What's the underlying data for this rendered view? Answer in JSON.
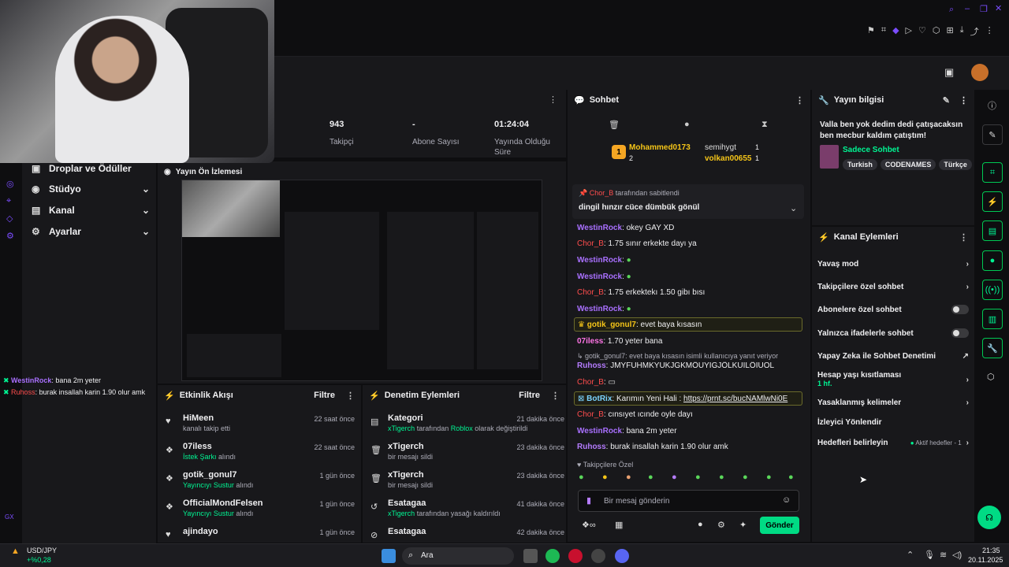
{
  "title_bar": {
    "icons": [
      "search-icon",
      "restore-icon",
      "maximize-icon",
      "close-icon"
    ]
  },
  "toolbar_icons": [
    "bookmark-icon",
    "crop-icon",
    "shield-icon",
    "play-icon",
    "heart-icon",
    "extension-icon",
    "apps-icon",
    "download-icon",
    "share-icon",
    "more-icon"
  ],
  "stats": [
    {
      "value": "943",
      "label": "Takipçi"
    },
    {
      "value": "-",
      "label": "Abone Sayısı"
    },
    {
      "value": "01:24:04",
      "label": "Yayında Olduğu Süre"
    }
  ],
  "nav": [
    {
      "label": "Droplar ve Ödüller"
    },
    {
      "label": "Stüdyo"
    },
    {
      "label": "Kanal"
    },
    {
      "label": "Ayarlar"
    }
  ],
  "preview": {
    "title": "Yayın Ön İzlemesi"
  },
  "overlay_chat": [
    {
      "user": "WestinRock",
      "msg": ": bana 2m yeter"
    },
    {
      "user": "Ruhoss",
      "msg": ": burak insallah karin 1.90 olur amk"
    }
  ],
  "activity": {
    "title": "Etkinlik Akışı",
    "filter": "Filtre",
    "items": [
      {
        "name": "HiMeen",
        "desc": "kanalı takip etti",
        "desc_hl": "",
        "time": "22 saat önce"
      },
      {
        "name": "07iless",
        "desc": " alındı",
        "desc_hl": "İstek Şarkı",
        "time": "22 saat önce"
      },
      {
        "name": "gotik_gonul7",
        "desc": " alındı",
        "desc_hl": "Yayıncıyı Sustur",
        "time": "1 gün önce"
      },
      {
        "name": "OfficialMondFelsen",
        "desc": " alındı",
        "desc_hl": "Yayıncıyı Sustur",
        "time": "1 gün önce"
      },
      {
        "name": "ajindayo",
        "desc": "",
        "desc_hl": "",
        "time": "1 gün önce"
      }
    ]
  },
  "moderation": {
    "title": "Denetim Eylemleri",
    "filter": "Filtre",
    "items": [
      {
        "name": "Kategori",
        "actor": "xTigerch",
        "desc": " tarafından ",
        "target": "Roblox",
        "tail": " olarak değiştirildi",
        "time": "21 dakika önce"
      },
      {
        "name": "xTigerch",
        "actor": "",
        "desc": "bir mesajı sildi",
        "target": "",
        "tail": "",
        "time": "23 dakika önce"
      },
      {
        "name": "xTigerch",
        "actor": "",
        "desc": "bir mesajı sildi",
        "target": "",
        "tail": "",
        "time": "23 dakika önce"
      },
      {
        "name": "Esatagaa",
        "actor": "xTigerch",
        "desc": " tarafından yasağı kaldırıldı",
        "target": "",
        "tail": "",
        "time": "41 dakika önce"
      },
      {
        "name": "Esatagaa",
        "actor": "",
        "desc": "",
        "target": "",
        "tail": "",
        "time": "42 dakika önce"
      }
    ]
  },
  "chat": {
    "title": "Sohbet",
    "leaders": [
      {
        "rank": "1",
        "name": "Mohammed0173",
        "count": "2"
      },
      {
        "name": "semihygt",
        "count": "1"
      },
      {
        "name": "volkan00655",
        "count": "1"
      }
    ],
    "pinned": {
      "by": "Chor_B",
      "by_text": " tarafından sabitlendi",
      "msg": "dingil hınzır cüce dümbük gönül"
    },
    "lines": [
      {
        "user": "WestinRock",
        "cls": "uw",
        "msg": ": okey GAY XD"
      },
      {
        "user": "Chor_B",
        "cls": "uc",
        "msg": ": 1.75 sınır erkekte dayı ya"
      },
      {
        "user": "WestinRock",
        "cls": "uw",
        "msg": ":"
      },
      {
        "user": "WestinRock",
        "cls": "uw",
        "msg": ":"
      },
      {
        "user": "Chor_B",
        "cls": "uc",
        "msg": ": 1.75 erkektekı 1.50 gibı bısı"
      },
      {
        "user": "WestinRock",
        "cls": "uw",
        "msg": ":"
      },
      {
        "user": "gotik_gonul7",
        "cls": "ug",
        "msg": ": evet baya kısasın"
      },
      {
        "user": "07iless",
        "cls": "u07",
        "msg": ": 1.70 yeter bana"
      },
      {
        "user": "Ruhoss",
        "cls": "ur",
        "msg": ": JMYFUHMKYUKJGKMÖUYIGJÖLKUILÖIUOL"
      },
      {
        "user": "Chor_B",
        "cls": "uc",
        "msg": ":"
      },
      {
        "user": "BotRix",
        "cls": "ub",
        "msg": ": Karımın Yeni Hali : "
      },
      {
        "user": "Chor_B",
        "cls": "uc",
        "msg": ": cınsıyet ıcınde oyle dayı"
      },
      {
        "user": "WestinRock",
        "cls": "uw",
        "msg": ": bana 2m yeter"
      },
      {
        "user": "Ruhoss",
        "cls": "ur",
        "msg": ": burak insallah karin 1.90 olur amk"
      }
    ],
    "reply_note": "gotik_gonul7: evet baya kısasın isimli kullanıcıya yanıt veriyor",
    "link": "https://prnt.sc/bucNAMlwNi0E",
    "emote_label": "Takipçilere Özel",
    "placeholder": "Bir mesaj gönderin",
    "send": "Gönder"
  },
  "info": {
    "title": "Yayın bilgisi",
    "stream_title": "Valla ben yok dedim dedi çatışacaksın ben mecbur kaldım çatıştım!",
    "category": "Sadece Sohbet",
    "tags": [
      "Turkish",
      "CODENAMES",
      "Türkçe"
    ]
  },
  "actions": {
    "title": "Kanal Eylemleri",
    "items": [
      {
        "label": "Yavaş mod",
        "kind": "chev",
        "sub": "",
        "extra": ""
      },
      {
        "label": "Takipçilere özel sohbet",
        "kind": "chev",
        "sub": "",
        "extra": ""
      },
      {
        "label": "Abonelere özel sohbet",
        "kind": "toggle",
        "sub": "",
        "extra": ""
      },
      {
        "label": "Yalnızca ifadelerle sohbet",
        "kind": "toggle",
        "sub": "",
        "extra": ""
      },
      {
        "label": "Yapay Zeka ile Sohbet Denetimi",
        "kind": "ext",
        "sub": "",
        "extra": ""
      },
      {
        "label": "Hesap yaşı kısıtlaması",
        "kind": "chev",
        "sub": "1 hf.",
        "extra": ""
      },
      {
        "label": "Yasaklanmış kelimeler",
        "kind": "chev",
        "sub": "",
        "extra": ""
      },
      {
        "label": "İzleyici Yönlendir",
        "kind": "none",
        "sub": "",
        "extra": ""
      },
      {
        "label": "Hedefleri belirleyin",
        "kind": "chev",
        "sub": "",
        "extra": "Aktif hedefler - 1"
      }
    ]
  },
  "taskbar": {
    "ticker": "USD/JPY",
    "ticker_change": "+%0,28",
    "search": "Ara",
    "time": "21:35",
    "date": "20.11.2025"
  },
  "misc": {
    "gx": "GX"
  }
}
